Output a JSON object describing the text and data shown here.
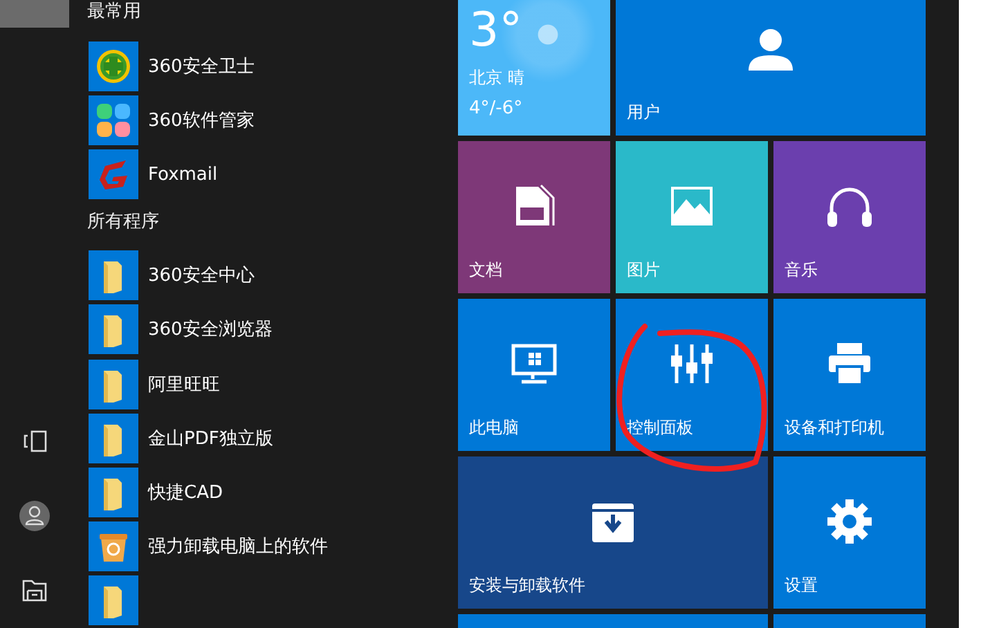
{
  "sections": [
    {
      "header": "最常用",
      "apps": [
        {
          "name": "360安全卫士",
          "kind": "shield"
        },
        {
          "name": "360软件管家",
          "kind": "flower"
        },
        {
          "name": "Foxmail",
          "kind": "foxmail"
        }
      ]
    },
    {
      "header": "所有程序",
      "apps": [
        {
          "name": "360安全中心",
          "kind": "folder"
        },
        {
          "name": "360安全浏览器",
          "kind": "folder"
        },
        {
          "name": "阿里旺旺",
          "kind": "folder"
        },
        {
          "name": "金山PDF独立版",
          "kind": "folder"
        },
        {
          "name": "快捷CAD",
          "kind": "folder"
        },
        {
          "name": "强力卸载电脑上的软件",
          "kind": "uninstall"
        },
        {
          "kind": "folder"
        }
      ]
    }
  ],
  "tiles": [
    {
      "kind": "weather",
      "temperature": "3°",
      "city": "北京",
      "condition": "晴",
      "range": "4°/-6°",
      "color": "#4cb8f8"
    },
    {
      "kind": "user",
      "label": "用户",
      "wide": true,
      "color": "#0078d7"
    },
    {
      "kind": "document",
      "label": "文档",
      "color": "#7e3878"
    },
    {
      "kind": "picture",
      "label": "图片",
      "color": "#2ab9c9"
    },
    {
      "kind": "music",
      "label": "音乐",
      "color": "#6b3fae"
    },
    {
      "kind": "computer",
      "label": "此电脑",
      "color": "#0078d7"
    },
    {
      "kind": "control",
      "label": "控制面板",
      "color": "#0078d7"
    },
    {
      "kind": "printer",
      "label": "设备和打印机",
      "color": "#0078d7"
    },
    {
      "kind": "install",
      "label": "安装与卸载软件",
      "wide": true,
      "color": "#17478a"
    },
    {
      "kind": "settings",
      "label": "设置",
      "color": "#0078d7"
    },
    {
      "kind": "blank",
      "wide": true,
      "color": "#0078d7"
    },
    {
      "kind": "blank",
      "color": "#0078d7"
    }
  ]
}
